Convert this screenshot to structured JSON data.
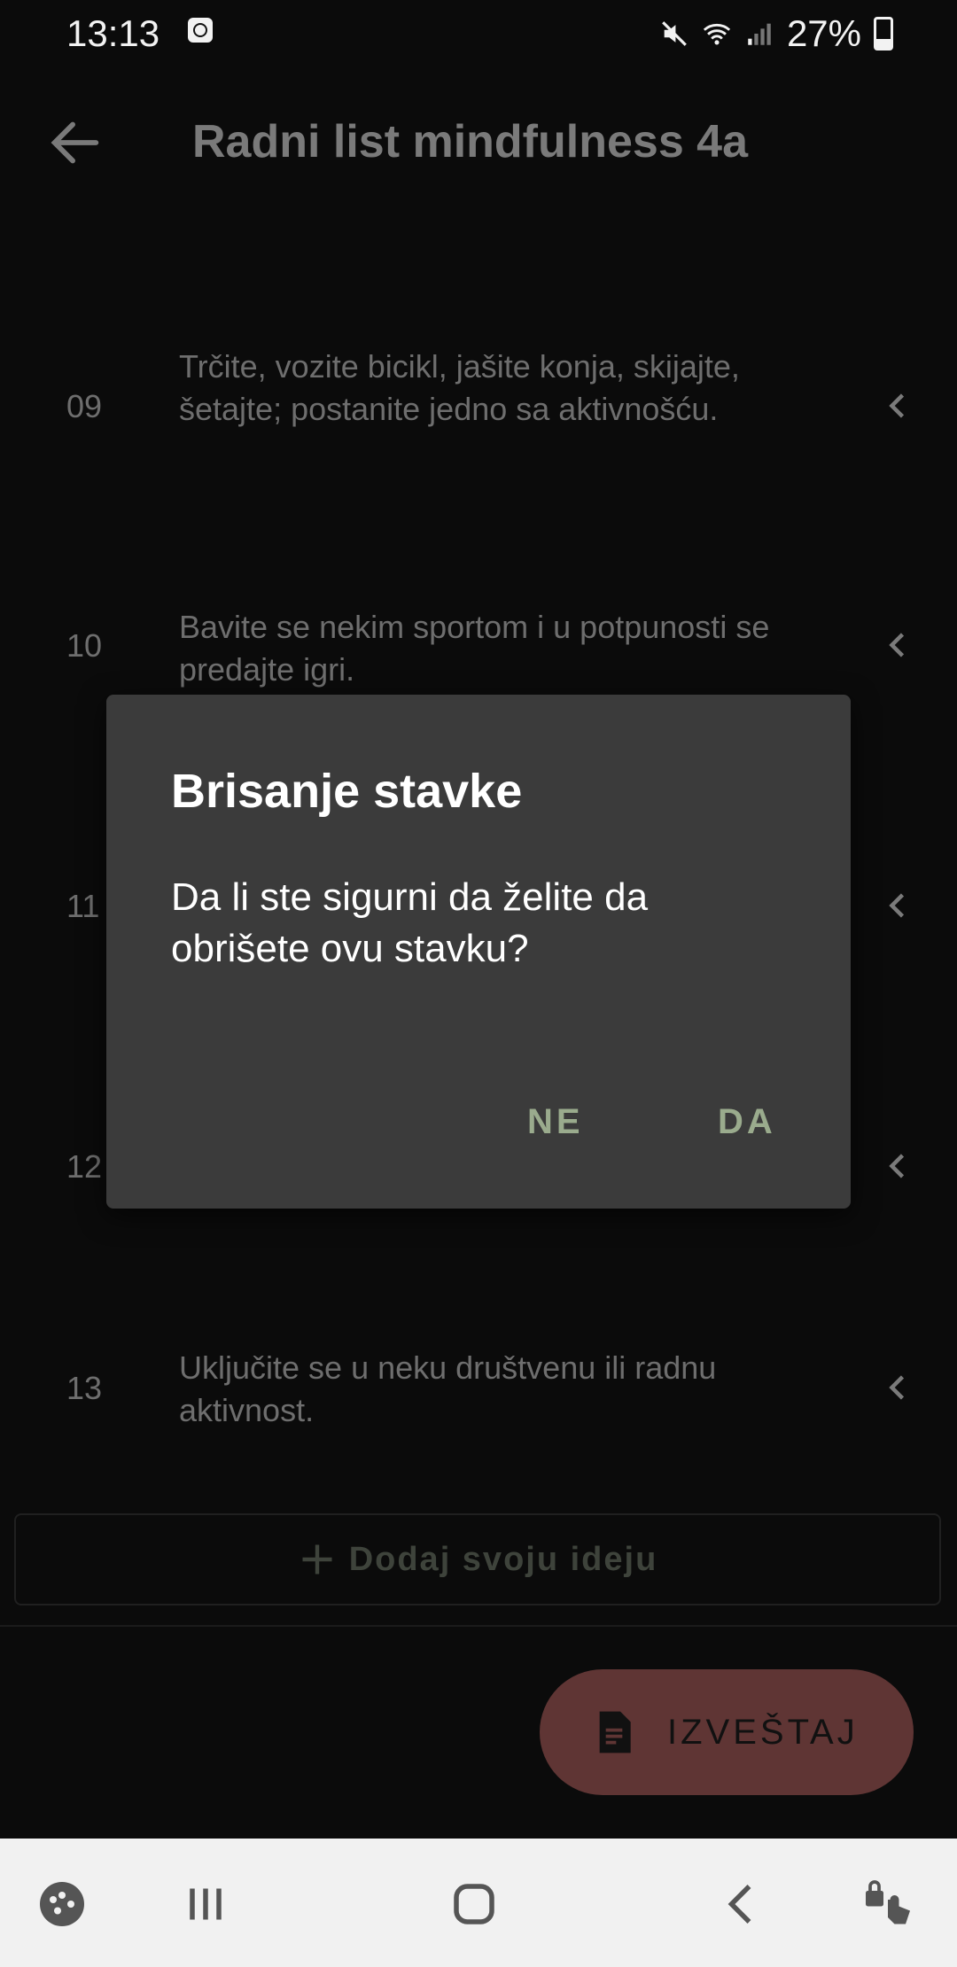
{
  "status_bar": {
    "time": "13:13",
    "battery": "27%"
  },
  "app_bar": {
    "title": "Radni list mindfulness 4a"
  },
  "items": [
    {
      "num": "09",
      "text": "Trčite, vozite bicikl, jašite konja, skijajte, šetajte; postanite jedno sa aktivnošću."
    },
    {
      "num": "10",
      "text": "Bavite se nekim sportom i u potpunosti se predajte igri."
    },
    {
      "num": "11",
      "text": ""
    },
    {
      "num": "12",
      "text": ""
    },
    {
      "num": "13",
      "text": "Uključite se u neku društvenu ili radnu aktivnost."
    }
  ],
  "add_button": {
    "label": "Dodaj svoju ideju"
  },
  "fab": {
    "label": "IZVEŠTAJ"
  },
  "dialog": {
    "title": "Brisanje stavke",
    "message": "Da li ste sigurni da želite da obrišete ovu stavku?",
    "negative": "NE",
    "positive": "DA"
  },
  "colors": {
    "dialog_bg": "#3b3b3b",
    "dialog_button": "#9aab8d",
    "fab_bg": "#5f3534",
    "background": "#0b0b0b"
  }
}
